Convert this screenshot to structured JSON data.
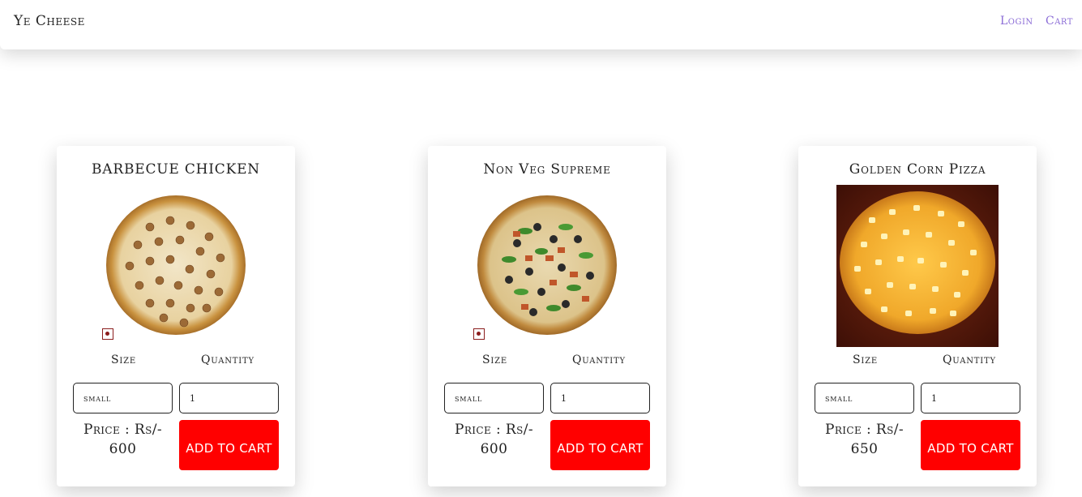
{
  "navbar": {
    "brand": "Ye Cheese",
    "login_label": "Login",
    "cart_label": "Cart",
    "link_color": "#8a6bd6"
  },
  "products": [
    {
      "title": "BARBECUE CHICKEN",
      "image": "barbecue-chicken-pizza",
      "non_veg": true,
      "size_label": "Size",
      "quantity_label": "Quantity",
      "size_value": "small",
      "quantity_value": "1",
      "price_label": "Price : Rs/-",
      "price_value": "600",
      "button_label": "ADD TO CART"
    },
    {
      "title": "Non Veg Supreme",
      "image": "non-veg-supreme-pizza",
      "non_veg": true,
      "size_label": "Size",
      "quantity_label": "Quantity",
      "size_value": "small",
      "quantity_value": "1",
      "price_label": "Price : Rs/-",
      "price_value": "600",
      "button_label": "ADD TO CART"
    },
    {
      "title": "Golden Corn Pizza",
      "image": "golden-corn-pizza",
      "non_veg": false,
      "size_label": "Size",
      "quantity_label": "Quantity",
      "size_value": "small",
      "quantity_value": "1",
      "price_label": "Price : Rs/-",
      "price_value": "650",
      "button_label": "ADD TO CART"
    }
  ],
  "colors": {
    "button": "#ff0000",
    "nonveg_mark": "#8b1d1d"
  }
}
